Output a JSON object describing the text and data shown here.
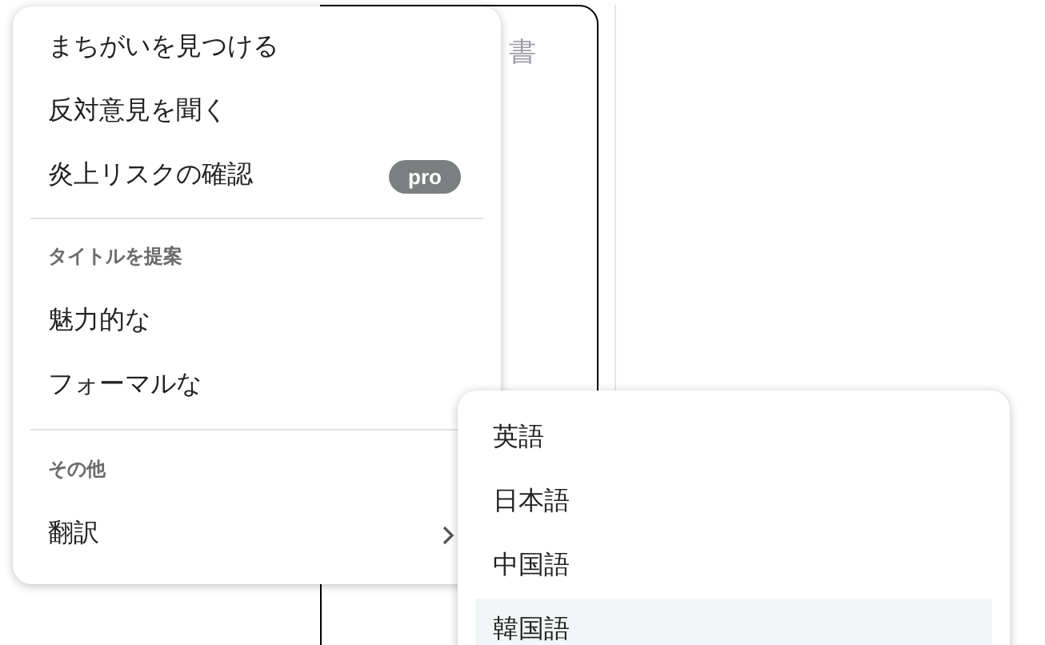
{
  "editor": {
    "placeholder": "書"
  },
  "menu": {
    "items": [
      {
        "kind": "item",
        "label": "まちがいを見つける"
      },
      {
        "kind": "item",
        "label": "反対意見を聞く"
      },
      {
        "kind": "item",
        "label": "炎上リスクの確認",
        "badge": "pro"
      },
      {
        "kind": "divider"
      },
      {
        "kind": "header",
        "label": "タイトルを提案"
      },
      {
        "kind": "item",
        "label": "魅力的な"
      },
      {
        "kind": "item",
        "label": "フォーマルな"
      },
      {
        "kind": "divider"
      },
      {
        "kind": "header",
        "label": "その他"
      },
      {
        "kind": "item",
        "label": "翻訳",
        "submenu": true
      }
    ]
  },
  "submenu": {
    "items": [
      {
        "label": "英語",
        "selected": false
      },
      {
        "label": "日本語",
        "selected": false
      },
      {
        "label": "中国語",
        "selected": false
      },
      {
        "label": "韓国語",
        "selected": true
      }
    ]
  }
}
